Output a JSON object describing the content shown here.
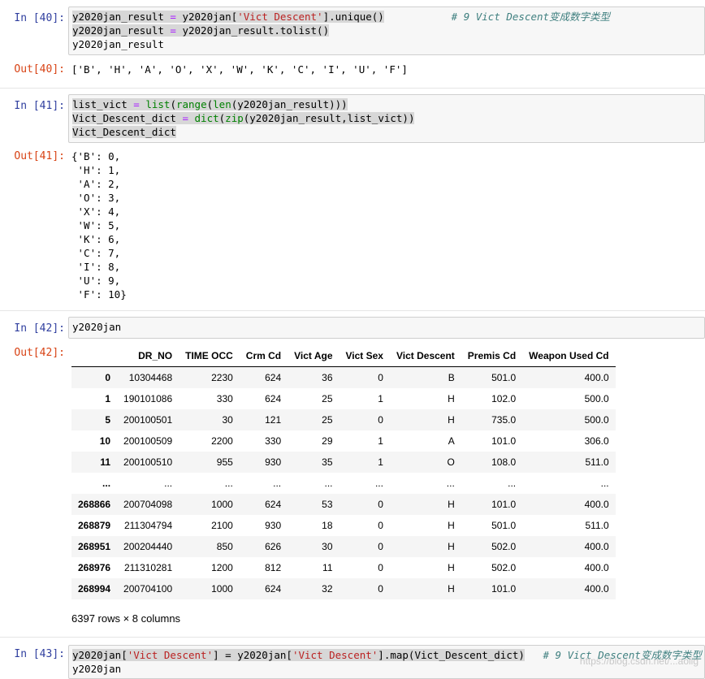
{
  "cells": [
    {
      "in_prompt": "In  [40]:",
      "out_prompt": "Out[40]:",
      "output": "['B', 'H', 'A', 'O', 'X', 'W', 'K', 'C', 'I', 'U', 'F']"
    },
    {
      "in_prompt": "In  [41]:",
      "out_prompt": "Out[41]:",
      "output": "{'B': 0,\n 'H': 1,\n 'A': 2,\n 'O': 3,\n 'X': 4,\n 'W': 5,\n 'K': 6,\n 'C': 7,\n 'I': 8,\n 'U': 9,\n 'F': 10}"
    },
    {
      "in_prompt": "In  [42]:",
      "out_prompt": "Out[42]:",
      "code": "y2020jan"
    },
    {
      "in_prompt": "In  [43]:"
    }
  ],
  "code_tokens": {
    "c40_l1a": "y2020jan_result",
    "c40_l1b": " = y2020jan[",
    "c40_l1c": "'Vict Descent'",
    "c40_l1d": "].unique()",
    "c40_l1e": "# 9 Vict Descent变成数字类型",
    "c40_l2a": "y2020jan_result",
    "c40_l2b": " = y2020jan_result.tolist()",
    "c40_l3": "y2020jan_result",
    "c41_l1a": "list_vict",
    "c41_l1b": " = ",
    "c41_l1c": "list",
    "c41_l1d": "(",
    "c41_l1e": "range",
    "c41_l1f": "(",
    "c41_l1g": "len",
    "c41_l1h": "(y2020jan_result)))",
    "c41_l2a": "Vict_Descent_dict",
    "c41_l2b": " = ",
    "c41_l2c": "dict",
    "c41_l2d": "(",
    "c41_l2e": "zip",
    "c41_l2f": "(y2020jan_result,list_vict))",
    "c41_l3": "Vict_Descent_dict",
    "c43_l1a": "y2020jan[",
    "c43_l1b": "'Vict Descent'",
    "c43_l1c": "] = y2020jan[",
    "c43_l1d": "'Vict Descent'",
    "c43_l1e": "].map(Vict_Descent_dict)",
    "c43_l1f": "# 9 Vict Descent变成数字类型",
    "c43_l2": "y2020jan",
    "eq": "="
  },
  "dataframe": {
    "columns": [
      "",
      "DR_NO",
      "TIME OCC",
      "Crm Cd",
      "Vict Age",
      "Vict Sex",
      "Vict Descent",
      "Premis Cd",
      "Weapon Used Cd"
    ],
    "rows": [
      [
        "0",
        "10304468",
        "2230",
        "624",
        "36",
        "0",
        "B",
        "501.0",
        "400.0"
      ],
      [
        "1",
        "190101086",
        "330",
        "624",
        "25",
        "1",
        "H",
        "102.0",
        "500.0"
      ],
      [
        "5",
        "200100501",
        "30",
        "121",
        "25",
        "0",
        "H",
        "735.0",
        "500.0"
      ],
      [
        "10",
        "200100509",
        "2200",
        "330",
        "29",
        "1",
        "A",
        "101.0",
        "306.0"
      ],
      [
        "11",
        "200100510",
        "955",
        "930",
        "35",
        "1",
        "O",
        "108.0",
        "511.0"
      ],
      [
        "...",
        "...",
        "...",
        "...",
        "...",
        "...",
        "...",
        "...",
        "..."
      ],
      [
        "268866",
        "200704098",
        "1000",
        "624",
        "53",
        "0",
        "H",
        "101.0",
        "400.0"
      ],
      [
        "268879",
        "211304794",
        "2100",
        "930",
        "18",
        "0",
        "H",
        "501.0",
        "511.0"
      ],
      [
        "268951",
        "200204440",
        "850",
        "626",
        "30",
        "0",
        "H",
        "502.0",
        "400.0"
      ],
      [
        "268976",
        "211310281",
        "1200",
        "812",
        "11",
        "0",
        "H",
        "502.0",
        "400.0"
      ],
      [
        "268994",
        "200704100",
        "1000",
        "624",
        "32",
        "0",
        "H",
        "101.0",
        "400.0"
      ]
    ],
    "shape": "6397 rows × 8 columns"
  },
  "watermark": "https://blog.csdn.net/...aolig"
}
